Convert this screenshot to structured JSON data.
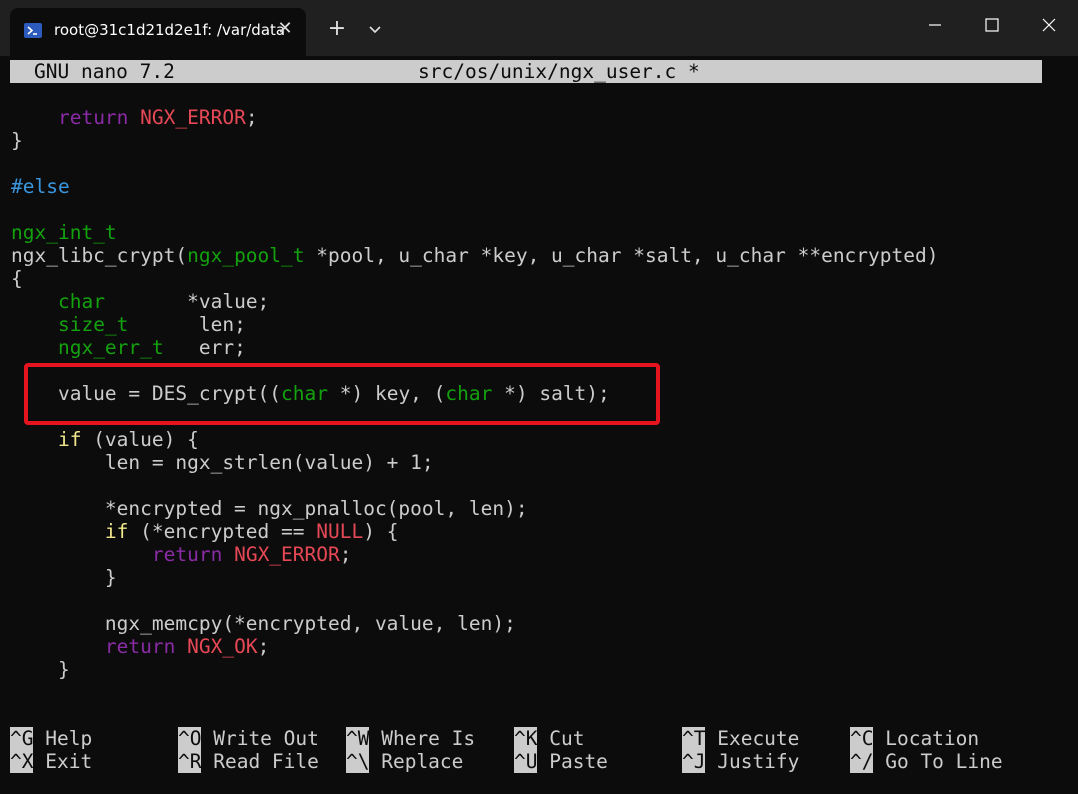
{
  "window": {
    "tab_title": "root@31c1d21d2e1f: /var/data",
    "tab_icon": "terminal-icon",
    "new_tab_glyph": "+",
    "close_glyph": "✕"
  },
  "nano": {
    "version": "GNU nano 7.2",
    "filename": "src/os/unix/ngx_user.c *"
  },
  "shortcuts": [
    {
      "key": "^G",
      "label": "Help"
    },
    {
      "key": "^X",
      "label": "Exit"
    },
    {
      "key": "^O",
      "label": "Write Out"
    },
    {
      "key": "^R",
      "label": "Read File"
    },
    {
      "key": "^W",
      "label": "Where Is"
    },
    {
      "key": "^\\",
      "label": "Replace"
    },
    {
      "key": "^K",
      "label": "Cut"
    },
    {
      "key": "^U",
      "label": "Paste"
    },
    {
      "key": "^T",
      "label": "Execute"
    },
    {
      "key": "^J",
      "label": "Justify"
    },
    {
      "key": "^C",
      "label": "Location"
    },
    {
      "key": "^/",
      "label": "Go To Line"
    }
  ],
  "code_lines": [
    [
      {
        "t": "    "
      },
      {
        "t": "return",
        "c": "kw"
      },
      {
        "t": " "
      },
      {
        "t": "NGX_ERROR",
        "c": "red"
      },
      {
        "t": ";"
      }
    ],
    [
      {
        "t": "}"
      }
    ],
    [
      {
        "t": ""
      }
    ],
    [
      {
        "t": "#else",
        "c": "cyan"
      }
    ],
    [
      {
        "t": ""
      }
    ],
    [
      {
        "t": "ngx_int_t",
        "c": "grn"
      }
    ],
    [
      {
        "t": "ngx_libc_crypt("
      },
      {
        "t": "ngx_pool_t",
        "c": "grn"
      },
      {
        "t": " *pool, u_char *key, u_char *salt, u_char **encrypted)"
      }
    ],
    [
      {
        "t": "{"
      }
    ],
    [
      {
        "t": "    "
      },
      {
        "t": "char",
        "c": "grn"
      },
      {
        "t": "       *value;"
      }
    ],
    [
      {
        "t": "    "
      },
      {
        "t": "size_t",
        "c": "grn"
      },
      {
        "t": "      len;"
      }
    ],
    [
      {
        "t": "    "
      },
      {
        "t": "ngx_err_t",
        "c": "grn"
      },
      {
        "t": "   err;"
      }
    ],
    [
      {
        "t": ""
      }
    ],
    [
      {
        "t": "    value = DES_crypt(("
      },
      {
        "t": "char",
        "c": "grn"
      },
      {
        "t": " *) key, ("
      },
      {
        "t": "char",
        "c": "grn"
      },
      {
        "t": " *) salt);"
      }
    ],
    [
      {
        "t": ""
      }
    ],
    [
      {
        "t": "    "
      },
      {
        "t": "if",
        "c": "yel"
      },
      {
        "t": " (value) {"
      }
    ],
    [
      {
        "t": "        len = ngx_strlen(value) + 1;"
      }
    ],
    [
      {
        "t": ""
      }
    ],
    [
      {
        "t": "        *encrypted = ngx_pnalloc(pool, len);"
      }
    ],
    [
      {
        "t": "        "
      },
      {
        "t": "if",
        "c": "yel"
      },
      {
        "t": " (*encrypted == "
      },
      {
        "t": "NULL",
        "c": "red"
      },
      {
        "t": ") {"
      }
    ],
    [
      {
        "t": "            "
      },
      {
        "t": "return",
        "c": "kw"
      },
      {
        "t": " "
      },
      {
        "t": "NGX_ERROR",
        "c": "red"
      },
      {
        "t": ";"
      }
    ],
    [
      {
        "t": "        }"
      }
    ],
    [
      {
        "t": ""
      }
    ],
    [
      {
        "t": "        ngx_memcpy(*encrypted, value, len);"
      }
    ],
    [
      {
        "t": "        "
      },
      {
        "t": "return",
        "c": "kw"
      },
      {
        "t": " "
      },
      {
        "t": "NGX_OK",
        "c": "red"
      },
      {
        "t": ";"
      }
    ],
    [
      {
        "t": "    }"
      }
    ]
  ]
}
